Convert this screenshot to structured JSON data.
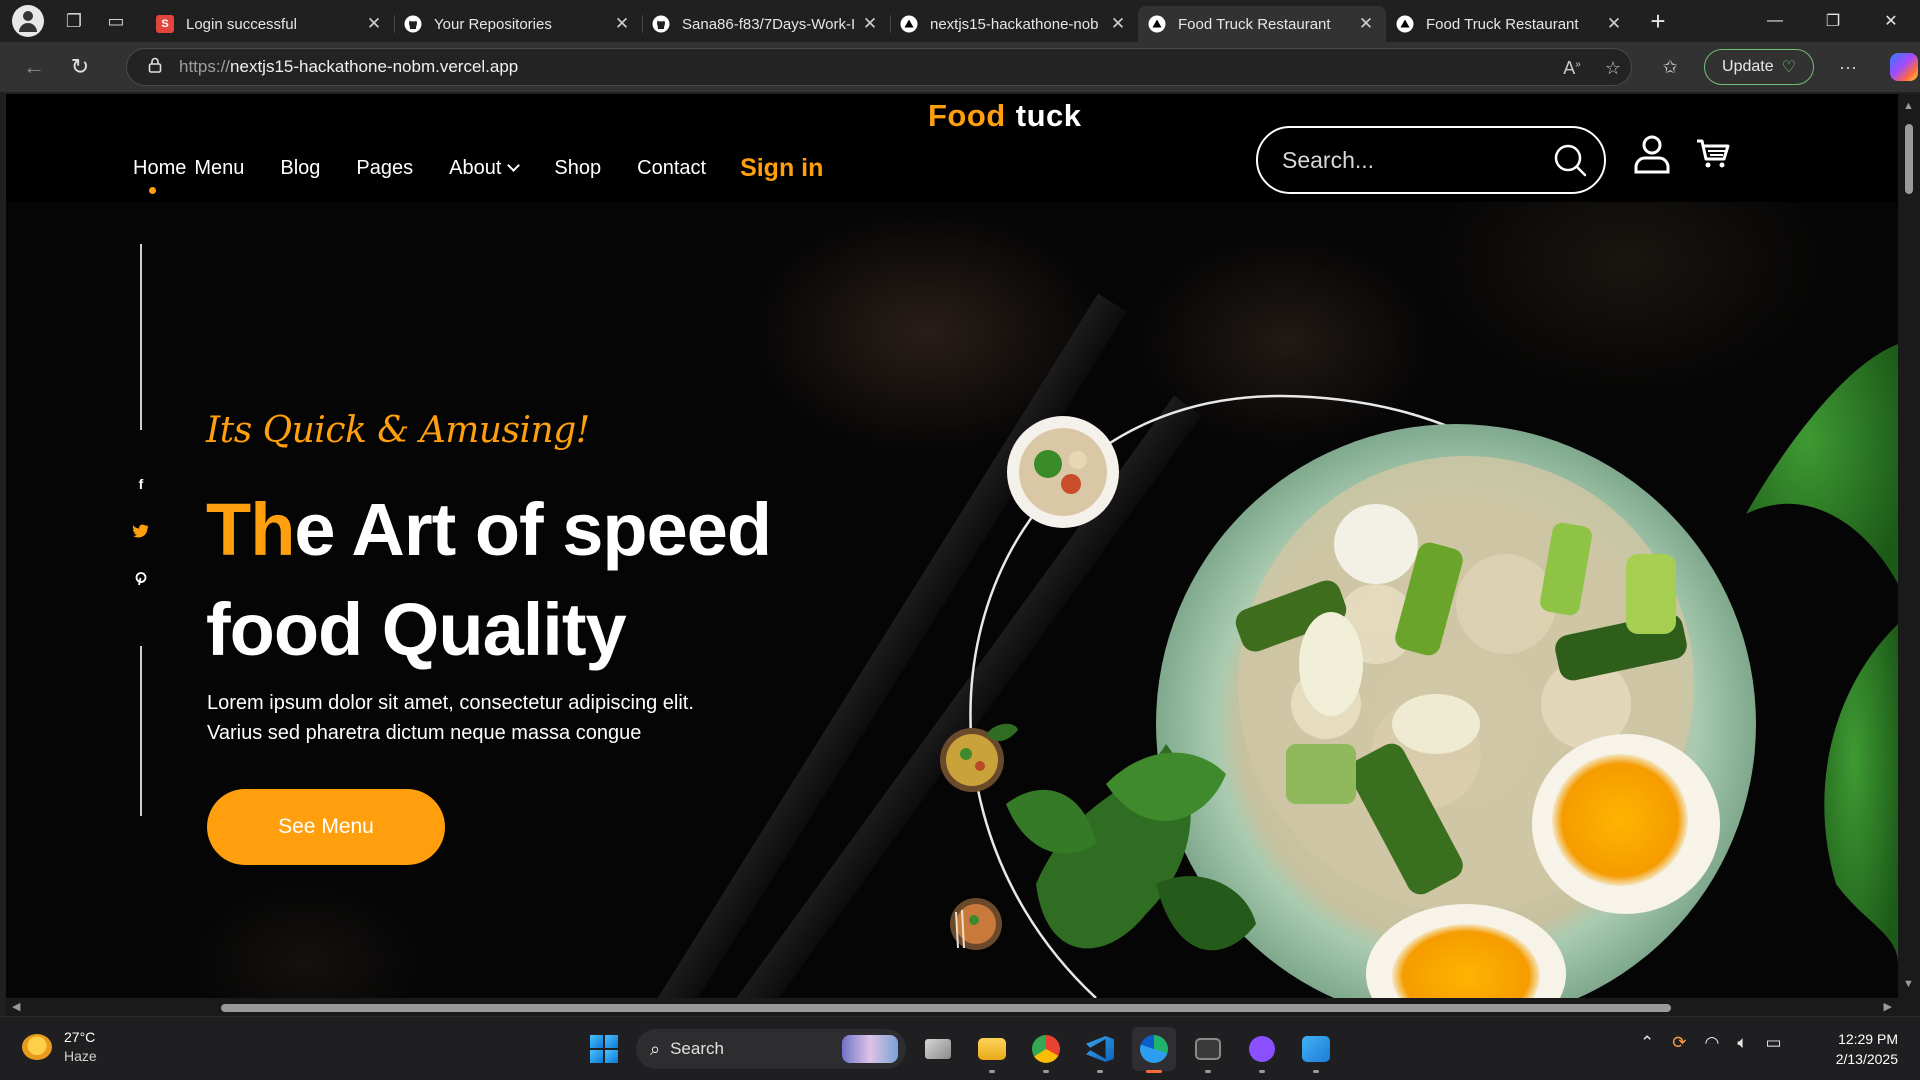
{
  "browser": {
    "tabs": [
      {
        "title": "Login successful",
        "favicon": "S",
        "favicon_color": "#e2453c"
      },
      {
        "title": "Your Repositories",
        "favicon": "github",
        "favicon_color": "#ffffff"
      },
      {
        "title": "Sana86-f83/7Days-Work-I",
        "favicon": "github",
        "favicon_color": "#ffffff"
      },
      {
        "title": "nextjs15-hackathone-nob",
        "favicon": "vercel",
        "favicon_color": "#ffffff"
      },
      {
        "title": "Food Truck Restaurant",
        "favicon": "vercel",
        "favicon_color": "#ffffff",
        "active": true
      },
      {
        "title": "Food Truck Restaurant",
        "favicon": "vercel",
        "favicon_color": "#ffffff"
      }
    ],
    "url_prefix": "https://",
    "url_host": "nextjs15-hackathone-nobm.vercel.app",
    "update_label": "Update"
  },
  "site": {
    "logo_part1": "Food",
    "logo_part2": "tuck",
    "nav": [
      "Home",
      "Menu",
      "Blog",
      "Pages",
      "About",
      "Shop",
      "Contact"
    ],
    "signin": "Sign in",
    "search_placeholder": "Search...",
    "tagline": "Its Quick & Amusing!",
    "headline_accent": "Th",
    "headline_rest1": "e Art of speed",
    "headline_line2": "food Quality",
    "desc_line1": "Lorem ipsum dolor sit amet, consectetur adipiscing elit.",
    "desc_line2": "Varius sed pharetra dictum neque massa congue",
    "cta": "See Menu",
    "social": [
      "f",
      "twitter",
      "p"
    ],
    "accent_color": "#FF9F0D"
  },
  "taskbar": {
    "temp": "27°C",
    "condition": "Haze",
    "search_label": "Search",
    "apps": [
      "file-explorer",
      "task-view",
      "folder",
      "chrome",
      "vscode",
      "edge",
      "terminal",
      "github-desktop",
      "paint"
    ],
    "time": "12:29 PM",
    "date": "2/13/2025"
  }
}
